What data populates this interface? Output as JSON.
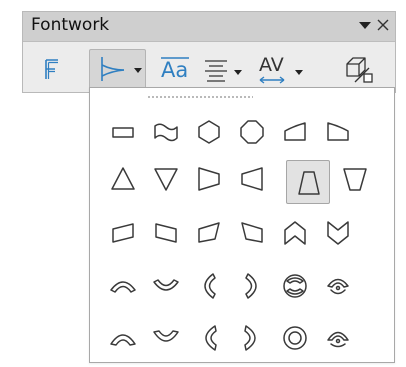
{
  "window": {
    "title": "Fontwork",
    "menu_icon": "dropdown-triangle-icon",
    "close_icon": "close-icon"
  },
  "toolbar": {
    "buttons": [
      {
        "name": "fontwork-gallery",
        "icon": "fontwork-f-icon",
        "color": "#2f7fc1"
      },
      {
        "name": "fontwork-shape",
        "icon": "fontwork-shape-icon",
        "color": "#2f7fc1",
        "active": true,
        "dropdown": true
      },
      {
        "name": "same-letter-heights",
        "icon": "same-letter-heights-icon",
        "text": "Aa",
        "color": "#2f7fc1"
      },
      {
        "name": "fontwork-alignment",
        "icon": "align-justified-icon",
        "dropdown": true
      },
      {
        "name": "character-spacing",
        "icon": "character-spacing-icon",
        "text": "AV",
        "color": "#2f7fc1",
        "dropdown": true
      },
      {
        "name": "toggle-extrusion",
        "icon": "extrusion-cube-icon"
      }
    ]
  },
  "shape_gallery": {
    "selected": "trapezoid-up",
    "rows": [
      [
        "plain-text",
        "wave",
        "stop",
        "ring-outside",
        "arch-down-curve",
        "arch-down-pour"
      ],
      [
        "triangle-up",
        "triangle-down",
        "fade-right",
        "fade-left",
        "trapezoid-up",
        "fade-down"
      ],
      [
        "slant-up",
        "slant-down",
        "fade-up-right",
        "fade-up-left",
        "chevron-up",
        "chevron-down"
      ],
      [
        "arch-up-curve",
        "arch-down-curve-2",
        "arch-left-curve",
        "arch-right-curve",
        "circle-curve",
        "open-circle-curve"
      ],
      [
        "arch-up-pour",
        "arch-down-pour-2",
        "arch-left-pour",
        "arch-right-pour",
        "circle-pour",
        "open-circle-pour"
      ]
    ]
  }
}
